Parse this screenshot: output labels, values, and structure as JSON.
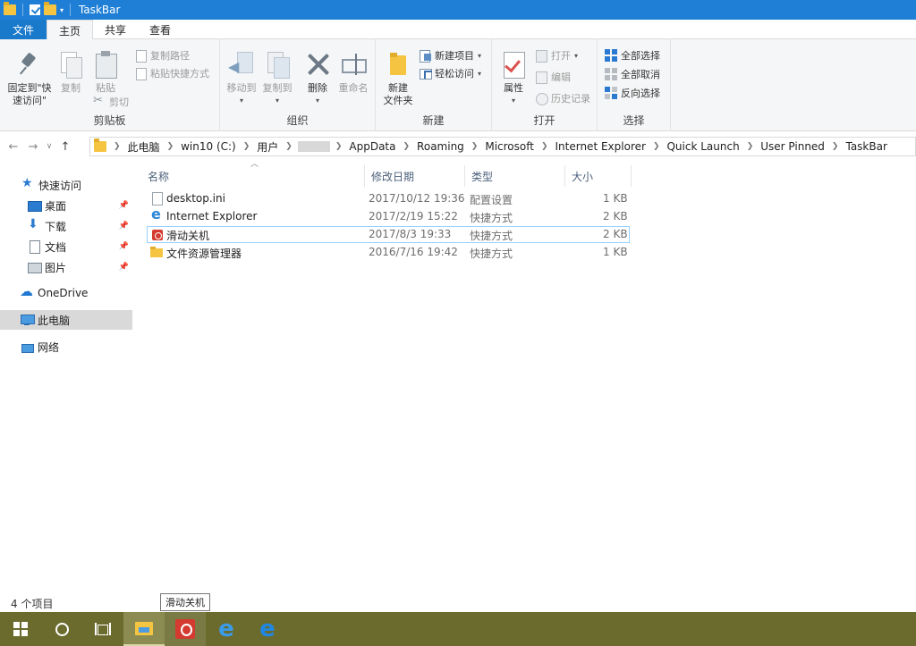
{
  "window": {
    "title": "TaskBar"
  },
  "ribbon_tabs": [
    {
      "label": "文件"
    },
    {
      "label": "主页"
    },
    {
      "label": "共享"
    },
    {
      "label": "查看"
    }
  ],
  "ribbon": {
    "clipboard": {
      "label": "剪贴板",
      "pin_label_1": "固定到\"快",
      "pin_label_2": "速访问\"",
      "copy": "复制",
      "paste": "粘贴",
      "copy_path": "复制路径",
      "paste_shortcut": "粘贴快捷方式",
      "cut": "剪切"
    },
    "organize": {
      "label": "组织",
      "move_to": "移动到",
      "copy_to": "复制到",
      "delete": "删除",
      "rename": "重命名"
    },
    "new": {
      "label": "新建",
      "new_folder_1": "新建",
      "new_folder_2": "文件夹",
      "new_item": "新建项目",
      "easy_access": "轻松访问"
    },
    "open": {
      "label": "打开",
      "properties": "属性",
      "open": "打开",
      "edit": "编辑",
      "history": "历史记录"
    },
    "select": {
      "label": "选择",
      "select_all": "全部选择",
      "select_none": "全部取消",
      "invert": "反向选择"
    }
  },
  "address": {
    "crumbs": [
      "此电脑",
      "win10 (C:)",
      "用户",
      "AppData",
      "Roaming",
      "Microsoft",
      "Internet Explorer",
      "Quick Launch",
      "User Pinned",
      "TaskBar"
    ]
  },
  "nav_pane": {
    "quick_access": "快速访问",
    "desktop": "桌面",
    "downloads": "下载",
    "documents": "文档",
    "pictures": "图片",
    "onedrive": "OneDrive",
    "this_pc": "此电脑",
    "network": "网络"
  },
  "columns": {
    "name": "名称",
    "modified": "修改日期",
    "type": "类型",
    "size": "大小"
  },
  "files": [
    {
      "name": "desktop.ini",
      "modified": "2017/10/12 19:36",
      "type": "配置设置",
      "size": "1 KB"
    },
    {
      "name": "Internet Explorer",
      "modified": "2017/2/19 15:22",
      "type": "快捷方式",
      "size": "2 KB"
    },
    {
      "name": "滑动关机",
      "modified": "2017/8/3 19:33",
      "type": "快捷方式",
      "size": "2 KB"
    },
    {
      "name": "文件资源管理器",
      "modified": "2016/7/16 19:42",
      "type": "快捷方式",
      "size": "1 KB"
    }
  ],
  "status": {
    "item_count": "4 个项目"
  },
  "tooltip": {
    "text": "滑动关机"
  },
  "taskbar": {
    "items": [
      "start",
      "search",
      "task-view",
      "file-explorer",
      "slide-shutdown",
      "internet-explorer",
      "edge"
    ]
  },
  "colors": {
    "titlebar": "#1f7fd6",
    "file_tab": "#1979ca",
    "taskbar": "#6b6b2e",
    "selection_border": "#99d1ff"
  }
}
